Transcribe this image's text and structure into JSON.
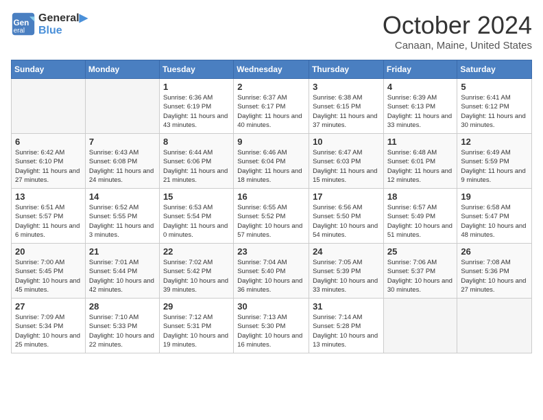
{
  "header": {
    "logo_line1": "General",
    "logo_line2": "Blue",
    "month": "October 2024",
    "location": "Canaan, Maine, United States"
  },
  "weekdays": [
    "Sunday",
    "Monday",
    "Tuesday",
    "Wednesday",
    "Thursday",
    "Friday",
    "Saturday"
  ],
  "weeks": [
    [
      {
        "day": "",
        "info": ""
      },
      {
        "day": "",
        "info": ""
      },
      {
        "day": "1",
        "info": "Sunrise: 6:36 AM\nSunset: 6:19 PM\nDaylight: 11 hours and 43 minutes."
      },
      {
        "day": "2",
        "info": "Sunrise: 6:37 AM\nSunset: 6:17 PM\nDaylight: 11 hours and 40 minutes."
      },
      {
        "day": "3",
        "info": "Sunrise: 6:38 AM\nSunset: 6:15 PM\nDaylight: 11 hours and 37 minutes."
      },
      {
        "day": "4",
        "info": "Sunrise: 6:39 AM\nSunset: 6:13 PM\nDaylight: 11 hours and 33 minutes."
      },
      {
        "day": "5",
        "info": "Sunrise: 6:41 AM\nSunset: 6:12 PM\nDaylight: 11 hours and 30 minutes."
      }
    ],
    [
      {
        "day": "6",
        "info": "Sunrise: 6:42 AM\nSunset: 6:10 PM\nDaylight: 11 hours and 27 minutes."
      },
      {
        "day": "7",
        "info": "Sunrise: 6:43 AM\nSunset: 6:08 PM\nDaylight: 11 hours and 24 minutes."
      },
      {
        "day": "8",
        "info": "Sunrise: 6:44 AM\nSunset: 6:06 PM\nDaylight: 11 hours and 21 minutes."
      },
      {
        "day": "9",
        "info": "Sunrise: 6:46 AM\nSunset: 6:04 PM\nDaylight: 11 hours and 18 minutes."
      },
      {
        "day": "10",
        "info": "Sunrise: 6:47 AM\nSunset: 6:03 PM\nDaylight: 11 hours and 15 minutes."
      },
      {
        "day": "11",
        "info": "Sunrise: 6:48 AM\nSunset: 6:01 PM\nDaylight: 11 hours and 12 minutes."
      },
      {
        "day": "12",
        "info": "Sunrise: 6:49 AM\nSunset: 5:59 PM\nDaylight: 11 hours and 9 minutes."
      }
    ],
    [
      {
        "day": "13",
        "info": "Sunrise: 6:51 AM\nSunset: 5:57 PM\nDaylight: 11 hours and 6 minutes."
      },
      {
        "day": "14",
        "info": "Sunrise: 6:52 AM\nSunset: 5:55 PM\nDaylight: 11 hours and 3 minutes."
      },
      {
        "day": "15",
        "info": "Sunrise: 6:53 AM\nSunset: 5:54 PM\nDaylight: 11 hours and 0 minutes."
      },
      {
        "day": "16",
        "info": "Sunrise: 6:55 AM\nSunset: 5:52 PM\nDaylight: 10 hours and 57 minutes."
      },
      {
        "day": "17",
        "info": "Sunrise: 6:56 AM\nSunset: 5:50 PM\nDaylight: 10 hours and 54 minutes."
      },
      {
        "day": "18",
        "info": "Sunrise: 6:57 AM\nSunset: 5:49 PM\nDaylight: 10 hours and 51 minutes."
      },
      {
        "day": "19",
        "info": "Sunrise: 6:58 AM\nSunset: 5:47 PM\nDaylight: 10 hours and 48 minutes."
      }
    ],
    [
      {
        "day": "20",
        "info": "Sunrise: 7:00 AM\nSunset: 5:45 PM\nDaylight: 10 hours and 45 minutes."
      },
      {
        "day": "21",
        "info": "Sunrise: 7:01 AM\nSunset: 5:44 PM\nDaylight: 10 hours and 42 minutes."
      },
      {
        "day": "22",
        "info": "Sunrise: 7:02 AM\nSunset: 5:42 PM\nDaylight: 10 hours and 39 minutes."
      },
      {
        "day": "23",
        "info": "Sunrise: 7:04 AM\nSunset: 5:40 PM\nDaylight: 10 hours and 36 minutes."
      },
      {
        "day": "24",
        "info": "Sunrise: 7:05 AM\nSunset: 5:39 PM\nDaylight: 10 hours and 33 minutes."
      },
      {
        "day": "25",
        "info": "Sunrise: 7:06 AM\nSunset: 5:37 PM\nDaylight: 10 hours and 30 minutes."
      },
      {
        "day": "26",
        "info": "Sunrise: 7:08 AM\nSunset: 5:36 PM\nDaylight: 10 hours and 27 minutes."
      }
    ],
    [
      {
        "day": "27",
        "info": "Sunrise: 7:09 AM\nSunset: 5:34 PM\nDaylight: 10 hours and 25 minutes."
      },
      {
        "day": "28",
        "info": "Sunrise: 7:10 AM\nSunset: 5:33 PM\nDaylight: 10 hours and 22 minutes."
      },
      {
        "day": "29",
        "info": "Sunrise: 7:12 AM\nSunset: 5:31 PM\nDaylight: 10 hours and 19 minutes."
      },
      {
        "day": "30",
        "info": "Sunrise: 7:13 AM\nSunset: 5:30 PM\nDaylight: 10 hours and 16 minutes."
      },
      {
        "day": "31",
        "info": "Sunrise: 7:14 AM\nSunset: 5:28 PM\nDaylight: 10 hours and 13 minutes."
      },
      {
        "day": "",
        "info": ""
      },
      {
        "day": "",
        "info": ""
      }
    ]
  ]
}
